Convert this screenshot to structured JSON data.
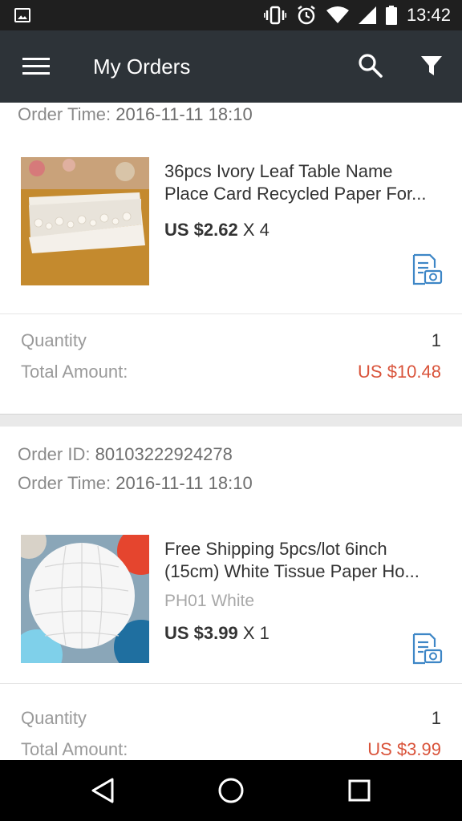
{
  "status_bar": {
    "time": "13:42",
    "icons": [
      "image-icon",
      "vibrate-icon",
      "alarm-icon",
      "wifi-icon",
      "signal-icon",
      "battery-icon"
    ]
  },
  "app_bar": {
    "title": "My Orders",
    "icons": [
      "menu-icon",
      "search-icon",
      "filter-icon"
    ]
  },
  "orders": [
    {
      "order_time_label": "Order Time:",
      "order_time": "2016-11-11 18:10",
      "product": {
        "title_line1": "36pcs Ivory Leaf Table Name",
        "title_line2": "Place Card Recycled Paper For...",
        "price": "US $2.62",
        "qty_text": "X 4"
      },
      "quantity_label": "Quantity",
      "quantity": "1",
      "total_label": "Total Amount:",
      "total": "US $10.48"
    },
    {
      "order_id_label": "Order ID:",
      "order_id": "80103222924278",
      "order_time_label": "Order Time:",
      "order_time": "2016-11-11 18:10",
      "product": {
        "title_line1": "Free Shipping 5pcs/lot 6inch",
        "title_line2": "(15cm) White Tissue Paper Ho...",
        "variant": "PH01 White",
        "price": "US $3.99",
        "qty_text": "X 1"
      },
      "quantity_label": "Quantity",
      "quantity": "1",
      "total_label": "Total Amount:",
      "total": "US $3.99"
    }
  ],
  "colors": {
    "app_bar": "#2d3338",
    "price_red": "#d9533a",
    "icon_blue": "#3d86c6"
  },
  "nav_bar": {
    "icons": [
      "back-icon",
      "home-icon",
      "recents-icon"
    ]
  }
}
